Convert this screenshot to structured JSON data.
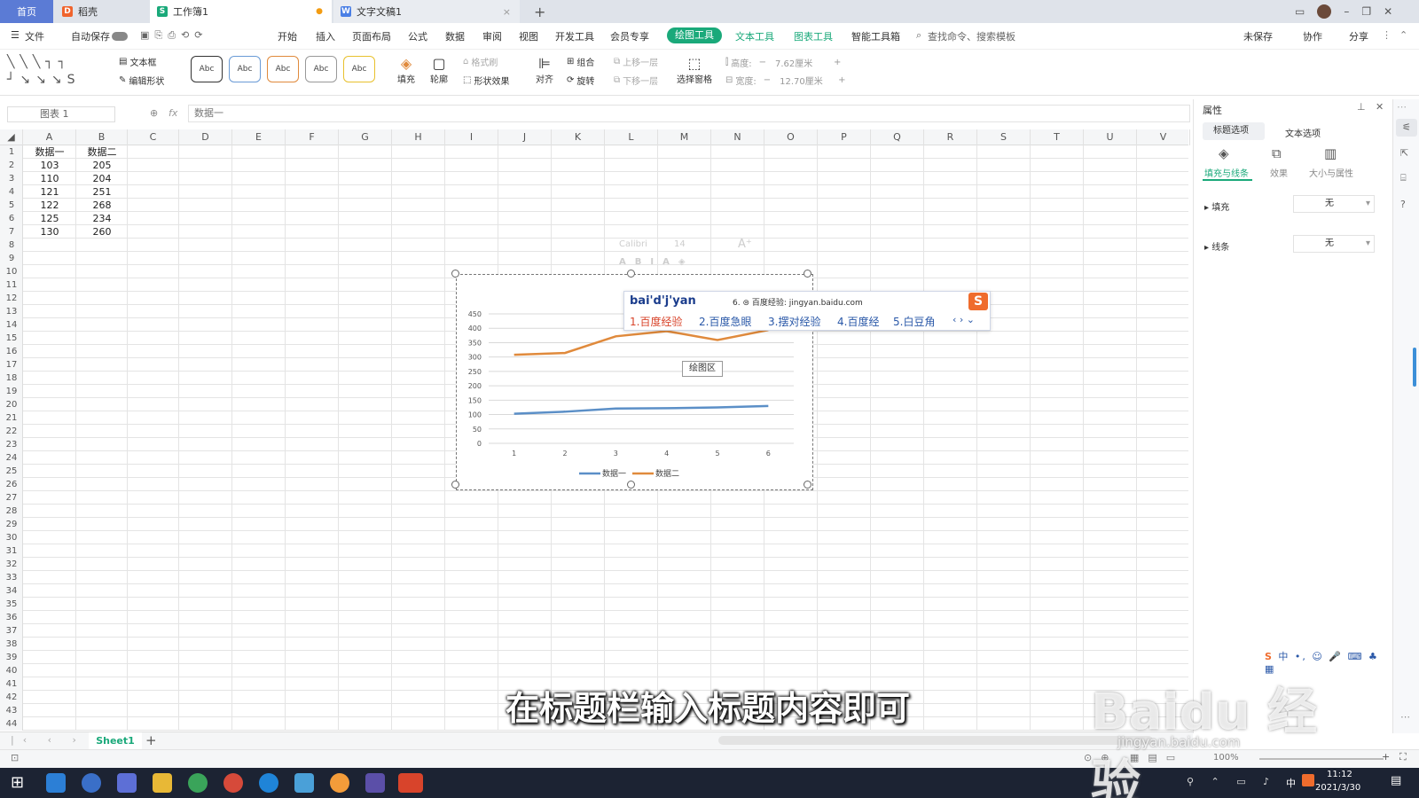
{
  "titlebar": {
    "home_tab": "首页",
    "tabs": [
      {
        "label": "稻壳"
      },
      {
        "label": "工作簿1",
        "modified_dot": "●"
      },
      {
        "label": "文字文稿1",
        "close": "×"
      }
    ],
    "new_tab": "+"
  },
  "menubar": {
    "file": "文件",
    "autosave": "自动保存",
    "items": [
      "开始",
      "插入",
      "页面布局",
      "公式",
      "数据",
      "审阅",
      "视图",
      "开发工具",
      "会员专享"
    ],
    "active_tab": "绘图工具",
    "context_tabs": [
      "文本工具",
      "图表工具",
      "智能工具箱"
    ],
    "search": "查找命令、搜索模板",
    "right": [
      "未保存",
      "协作",
      "分享"
    ]
  },
  "ribbon": {
    "textbox": "文本框",
    "edit_shape": "编辑形状",
    "style_samples": [
      "Abc",
      "Abc",
      "Abc",
      "Abc",
      "Abc"
    ],
    "fill": "填充",
    "outline": "轮廓",
    "format_brush": "格式刷",
    "shape_effect": "形状效果",
    "align": "对齐",
    "group": "组合",
    "rotate": "旋转",
    "bring_forward": "上移一层",
    "send_backward": "下移一层",
    "selection_pane": "选择窗格",
    "height_label": "高度:",
    "height_value": "7.62厘米",
    "width_label": "宽度:",
    "width_value": "12.70厘米"
  },
  "formulabar": {
    "namebox": "图表 1",
    "fx": "fx",
    "content": "数据一"
  },
  "columns": [
    "A",
    "B",
    "C",
    "D",
    "E",
    "F",
    "G",
    "H",
    "I",
    "J",
    "K",
    "L",
    "M",
    "N",
    "O",
    "P",
    "Q",
    "R",
    "S",
    "T",
    "U",
    "V"
  ],
  "rows": [
    "1",
    "2",
    "3",
    "4",
    "5",
    "6",
    "7",
    "8",
    "9",
    "10",
    "11",
    "12",
    "13",
    "14",
    "15",
    "16",
    "17",
    "18",
    "19",
    "20",
    "21",
    "22",
    "23",
    "24",
    "25",
    "26",
    "27",
    "28",
    "29",
    "30",
    "31",
    "32",
    "33",
    "34",
    "35",
    "36",
    "37",
    "38",
    "39",
    "40",
    "41",
    "42",
    "43",
    "44"
  ],
  "sheet": {
    "header": [
      "数据一",
      "数据二"
    ],
    "data": [
      [
        "103",
        "205"
      ],
      [
        "110",
        "204"
      ],
      [
        "121",
        "251"
      ],
      [
        "122",
        "268"
      ],
      [
        "125",
        "234"
      ],
      [
        "130",
        "260"
      ]
    ]
  },
  "font_toolbar": {
    "font": "Calibri",
    "size": "14"
  },
  "chart_data": {
    "type": "line",
    "categories": [
      "1",
      "2",
      "3",
      "4",
      "5",
      "6"
    ],
    "x": [
      1,
      2,
      3,
      4,
      5,
      6
    ],
    "series": [
      {
        "name": "数据一",
        "values": [
          103,
          110,
          121,
          122,
          125,
          130
        ],
        "color": "#5b8fc7"
      },
      {
        "name": "数据二",
        "values": [
          308,
          314,
          372,
          390,
          359,
          394
        ],
        "color": "#e08a3c"
      }
    ],
    "yticks": [
      "0",
      "50",
      "100",
      "150",
      "200",
      "250",
      "300",
      "350",
      "400",
      "450"
    ],
    "ylim": [
      0,
      450
    ],
    "grid": true,
    "legend_position": "bottom",
    "plot_area_tooltip": "绘图区"
  },
  "ime": {
    "input": "bai'd'j'yan",
    "hint": "6. ⊜ 百度经验: jingyan.baidu.com",
    "candidates": [
      "1.百度经验",
      "2.百度急眼",
      "3.摆对经验",
      "4.百度经",
      "5.白豆角"
    ]
  },
  "panel": {
    "title": "属性",
    "tab_title_options": "标题选项",
    "tab_text_options": "文本选项",
    "subtabs": [
      "填充与线条",
      "效果",
      "大小与属性"
    ],
    "fill_label": "填充",
    "fill_value": "无",
    "line_label": "线条",
    "line_value": "无"
  },
  "sheetbar": {
    "sheet1": "Sheet1",
    "add": "+"
  },
  "statusbar": {
    "zoom": "100%"
  },
  "taskbar": {
    "time": "11:12",
    "date": "2021/3/30",
    "ime_lang": "中"
  },
  "overlay": {
    "caption": "在标题栏输入标题内容即可",
    "watermark": "Baidu 经验",
    "watermark_url": "jingyan.baidu.com"
  },
  "colors": {
    "accent": "#1aa97a",
    "chart_blue": "#5b8fc7",
    "chart_orange": "#e08a3c"
  }
}
